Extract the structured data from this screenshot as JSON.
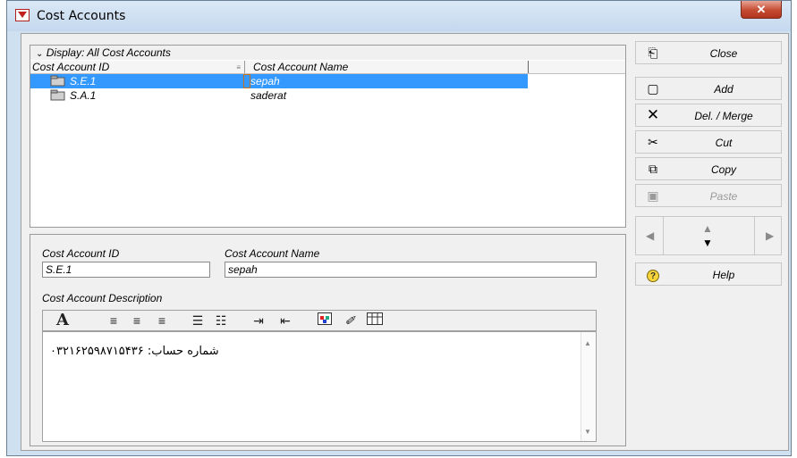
{
  "window": {
    "title": "Cost Accounts",
    "close_glyph": "✕"
  },
  "list": {
    "group_header": "Display: All Cost Accounts",
    "columns": [
      "Cost Account ID",
      "Cost Account Name"
    ],
    "rows": [
      {
        "id": "S.E.1",
        "name": "sepah",
        "selected": true
      },
      {
        "id": "S.A.1",
        "name": "saderat",
        "selected": false
      }
    ]
  },
  "detail": {
    "id_label": "Cost Account ID",
    "id_value": "S.E.1",
    "name_label": "Cost Account Name",
    "name_value": "sepah",
    "desc_label": "Cost Account Description",
    "desc_text": "شماره حساب: ۰۳۲۱۶۲۵۹۸۷۱۵۴۳۶"
  },
  "toolbar": {
    "icons": [
      "font-icon",
      "align-left-icon",
      "align-center-icon",
      "align-right-icon",
      "bullet-list-icon",
      "numbered-list-icon",
      "indent-icon",
      "outdent-icon",
      "color-icon",
      "link-icon",
      "table-icon"
    ]
  },
  "buttons": {
    "close": "Close",
    "add": "Add",
    "delete": "Del. / Merge",
    "cut": "Cut",
    "copy": "Copy",
    "paste": "Paste",
    "help": "Help"
  },
  "colors": {
    "selection": "#3399ff",
    "titlebar": "#c4d8ee",
    "close_button": "#c54b32"
  }
}
